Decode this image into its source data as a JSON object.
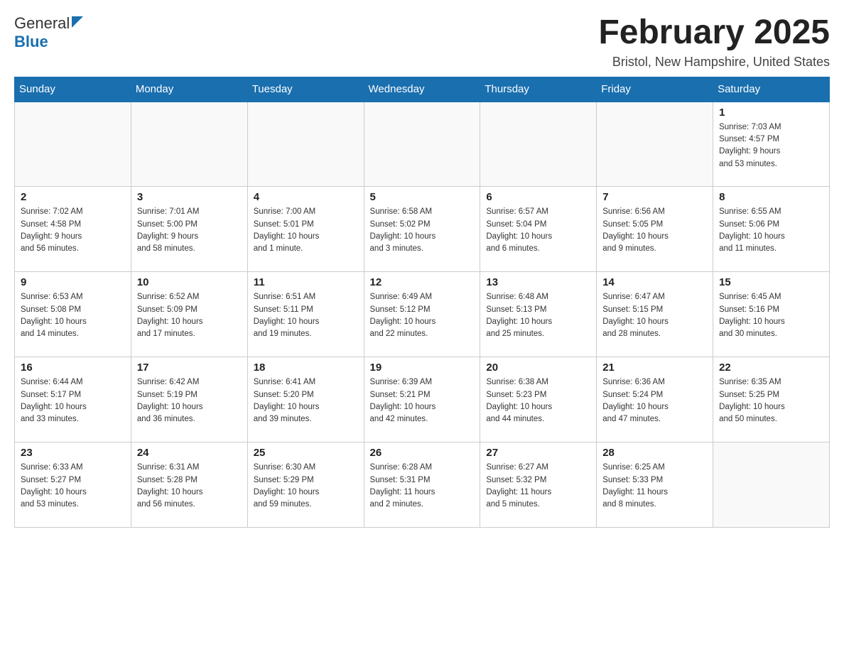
{
  "header": {
    "logo_general": "General",
    "logo_blue": "Blue",
    "month_title": "February 2025",
    "subtitle": "Bristol, New Hampshire, United States"
  },
  "days_of_week": [
    "Sunday",
    "Monday",
    "Tuesday",
    "Wednesday",
    "Thursday",
    "Friday",
    "Saturday"
  ],
  "weeks": [
    [
      {
        "day": "",
        "info": ""
      },
      {
        "day": "",
        "info": ""
      },
      {
        "day": "",
        "info": ""
      },
      {
        "day": "",
        "info": ""
      },
      {
        "day": "",
        "info": ""
      },
      {
        "day": "",
        "info": ""
      },
      {
        "day": "1",
        "info": "Sunrise: 7:03 AM\nSunset: 4:57 PM\nDaylight: 9 hours\nand 53 minutes."
      }
    ],
    [
      {
        "day": "2",
        "info": "Sunrise: 7:02 AM\nSunset: 4:58 PM\nDaylight: 9 hours\nand 56 minutes."
      },
      {
        "day": "3",
        "info": "Sunrise: 7:01 AM\nSunset: 5:00 PM\nDaylight: 9 hours\nand 58 minutes."
      },
      {
        "day": "4",
        "info": "Sunrise: 7:00 AM\nSunset: 5:01 PM\nDaylight: 10 hours\nand 1 minute."
      },
      {
        "day": "5",
        "info": "Sunrise: 6:58 AM\nSunset: 5:02 PM\nDaylight: 10 hours\nand 3 minutes."
      },
      {
        "day": "6",
        "info": "Sunrise: 6:57 AM\nSunset: 5:04 PM\nDaylight: 10 hours\nand 6 minutes."
      },
      {
        "day": "7",
        "info": "Sunrise: 6:56 AM\nSunset: 5:05 PM\nDaylight: 10 hours\nand 9 minutes."
      },
      {
        "day": "8",
        "info": "Sunrise: 6:55 AM\nSunset: 5:06 PM\nDaylight: 10 hours\nand 11 minutes."
      }
    ],
    [
      {
        "day": "9",
        "info": "Sunrise: 6:53 AM\nSunset: 5:08 PM\nDaylight: 10 hours\nand 14 minutes."
      },
      {
        "day": "10",
        "info": "Sunrise: 6:52 AM\nSunset: 5:09 PM\nDaylight: 10 hours\nand 17 minutes."
      },
      {
        "day": "11",
        "info": "Sunrise: 6:51 AM\nSunset: 5:11 PM\nDaylight: 10 hours\nand 19 minutes."
      },
      {
        "day": "12",
        "info": "Sunrise: 6:49 AM\nSunset: 5:12 PM\nDaylight: 10 hours\nand 22 minutes."
      },
      {
        "day": "13",
        "info": "Sunrise: 6:48 AM\nSunset: 5:13 PM\nDaylight: 10 hours\nand 25 minutes."
      },
      {
        "day": "14",
        "info": "Sunrise: 6:47 AM\nSunset: 5:15 PM\nDaylight: 10 hours\nand 28 minutes."
      },
      {
        "day": "15",
        "info": "Sunrise: 6:45 AM\nSunset: 5:16 PM\nDaylight: 10 hours\nand 30 minutes."
      }
    ],
    [
      {
        "day": "16",
        "info": "Sunrise: 6:44 AM\nSunset: 5:17 PM\nDaylight: 10 hours\nand 33 minutes."
      },
      {
        "day": "17",
        "info": "Sunrise: 6:42 AM\nSunset: 5:19 PM\nDaylight: 10 hours\nand 36 minutes."
      },
      {
        "day": "18",
        "info": "Sunrise: 6:41 AM\nSunset: 5:20 PM\nDaylight: 10 hours\nand 39 minutes."
      },
      {
        "day": "19",
        "info": "Sunrise: 6:39 AM\nSunset: 5:21 PM\nDaylight: 10 hours\nand 42 minutes."
      },
      {
        "day": "20",
        "info": "Sunrise: 6:38 AM\nSunset: 5:23 PM\nDaylight: 10 hours\nand 44 minutes."
      },
      {
        "day": "21",
        "info": "Sunrise: 6:36 AM\nSunset: 5:24 PM\nDaylight: 10 hours\nand 47 minutes."
      },
      {
        "day": "22",
        "info": "Sunrise: 6:35 AM\nSunset: 5:25 PM\nDaylight: 10 hours\nand 50 minutes."
      }
    ],
    [
      {
        "day": "23",
        "info": "Sunrise: 6:33 AM\nSunset: 5:27 PM\nDaylight: 10 hours\nand 53 minutes."
      },
      {
        "day": "24",
        "info": "Sunrise: 6:31 AM\nSunset: 5:28 PM\nDaylight: 10 hours\nand 56 minutes."
      },
      {
        "day": "25",
        "info": "Sunrise: 6:30 AM\nSunset: 5:29 PM\nDaylight: 10 hours\nand 59 minutes."
      },
      {
        "day": "26",
        "info": "Sunrise: 6:28 AM\nSunset: 5:31 PM\nDaylight: 11 hours\nand 2 minutes."
      },
      {
        "day": "27",
        "info": "Sunrise: 6:27 AM\nSunset: 5:32 PM\nDaylight: 11 hours\nand 5 minutes."
      },
      {
        "day": "28",
        "info": "Sunrise: 6:25 AM\nSunset: 5:33 PM\nDaylight: 11 hours\nand 8 minutes."
      },
      {
        "day": "",
        "info": ""
      }
    ]
  ]
}
